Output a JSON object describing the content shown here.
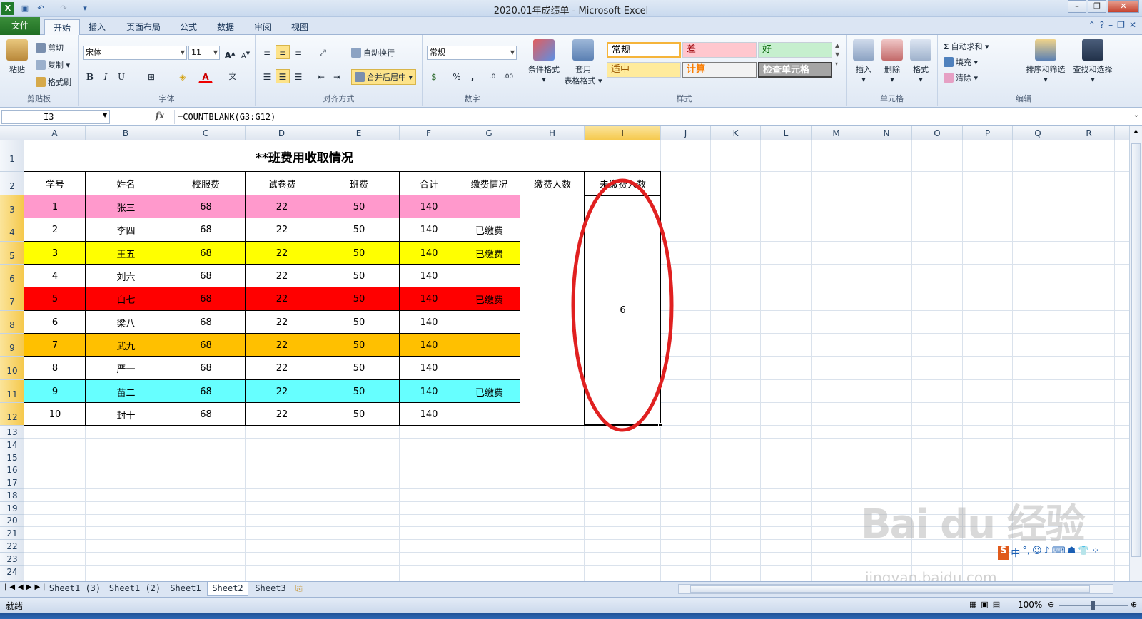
{
  "window": {
    "title": "2020.01年成绩单  -  Microsoft Excel"
  },
  "menu": {
    "tabs": [
      "文件",
      "开始",
      "插入",
      "页面布局",
      "公式",
      "数据",
      "审阅",
      "视图"
    ]
  },
  "ribbon": {
    "clipboard": {
      "paste": "粘贴",
      "cut": "剪切",
      "copy": "复制",
      "format_painter": "格式刷",
      "label": "剪贴板"
    },
    "font": {
      "name": "宋体",
      "size": "11",
      "bold": "B",
      "italic": "I",
      "underline": "U",
      "label": "字体"
    },
    "alignment": {
      "wrap": "自动换行",
      "merge": "合并后居中",
      "label": "对齐方式"
    },
    "number": {
      "format": "常规",
      "percent": "%",
      "comma": ",",
      "label": "数字"
    },
    "styles": {
      "conditional": "条件格式",
      "table_line1": "套用",
      "table_line2": "表格格式",
      "cells": [
        "常规",
        "差",
        "好",
        "适中",
        "计算",
        "检查单元格"
      ],
      "label": "样式"
    },
    "cells": {
      "insert": "插入",
      "delete": "删除",
      "format": "格式",
      "label": "单元格"
    },
    "editing": {
      "autosum": "自动求和",
      "fill": "填充",
      "clear": "清除",
      "sort": "排序和筛选",
      "find": "查找和选择",
      "label": "编辑"
    }
  },
  "formula_bar": {
    "name_box": "I3",
    "fx": "fx",
    "formula": "=COUNTBLANK(G3:G12)"
  },
  "columns": [
    "A",
    "B",
    "C",
    "D",
    "E",
    "F",
    "G",
    "H",
    "I",
    "J",
    "K",
    "L",
    "M",
    "N",
    "O",
    "P",
    "Q",
    "R"
  ],
  "rows": [
    "1",
    "2",
    "3",
    "4",
    "5",
    "6",
    "7",
    "8",
    "9",
    "10",
    "11",
    "12",
    "13",
    "14",
    "15",
    "16",
    "17",
    "18",
    "19",
    "20",
    "21",
    "22",
    "23",
    "24"
  ],
  "table": {
    "title": "**班费用收取情况",
    "headers": [
      "学号",
      "姓名",
      "校服费",
      "试卷费",
      "班费",
      "合计",
      "缴费情况",
      "缴费人数",
      "未缴费人数"
    ],
    "rows": [
      {
        "id": "1",
        "name": "张三",
        "uniform": "68",
        "exam": "22",
        "class": "50",
        "total": "140",
        "status": "",
        "fill": "#ff99cc"
      },
      {
        "id": "2",
        "name": "李四",
        "uniform": "68",
        "exam": "22",
        "class": "50",
        "total": "140",
        "status": "已缴费",
        "fill": "#ffffff"
      },
      {
        "id": "3",
        "name": "王五",
        "uniform": "68",
        "exam": "22",
        "class": "50",
        "total": "140",
        "status": "已缴费",
        "fill": "#ffff00"
      },
      {
        "id": "4",
        "name": "刘六",
        "uniform": "68",
        "exam": "22",
        "class": "50",
        "total": "140",
        "status": "",
        "fill": "#ffffff"
      },
      {
        "id": "5",
        "name": "白七",
        "uniform": "68",
        "exam": "22",
        "class": "50",
        "total": "140",
        "status": "已缴费",
        "fill": "#ff0000"
      },
      {
        "id": "6",
        "name": "梁八",
        "uniform": "68",
        "exam": "22",
        "class": "50",
        "total": "140",
        "status": "",
        "fill": "#ffffff"
      },
      {
        "id": "7",
        "name": "武九",
        "uniform": "68",
        "exam": "22",
        "class": "50",
        "total": "140",
        "status": "",
        "fill": "#ffc000"
      },
      {
        "id": "8",
        "name": "严一",
        "uniform": "68",
        "exam": "22",
        "class": "50",
        "total": "140",
        "status": "",
        "fill": "#ffffff"
      },
      {
        "id": "9",
        "name": "苗二",
        "uniform": "68",
        "exam": "22",
        "class": "50",
        "total": "140",
        "status": "已缴费",
        "fill": "#66ffff"
      },
      {
        "id": "10",
        "name": "封十",
        "uniform": "68",
        "exam": "22",
        "class": "50",
        "total": "140",
        "status": "",
        "fill": "#ffffff"
      }
    ],
    "paid_count": "",
    "unpaid_count": "6"
  },
  "sheet_tabs": [
    "Sheet1 (3)",
    "Sheet1 (2)",
    "Sheet1",
    "Sheet2",
    "Sheet3"
  ],
  "active_sheet": "Sheet2",
  "status": {
    "ready": "就绪",
    "zoom": "100%"
  },
  "watermark": {
    "brand": "Bai du 经验",
    "url": "jingyan.baidu.com"
  },
  "colors": {
    "annotation": "#e02020",
    "accent": "#f5c84a"
  }
}
